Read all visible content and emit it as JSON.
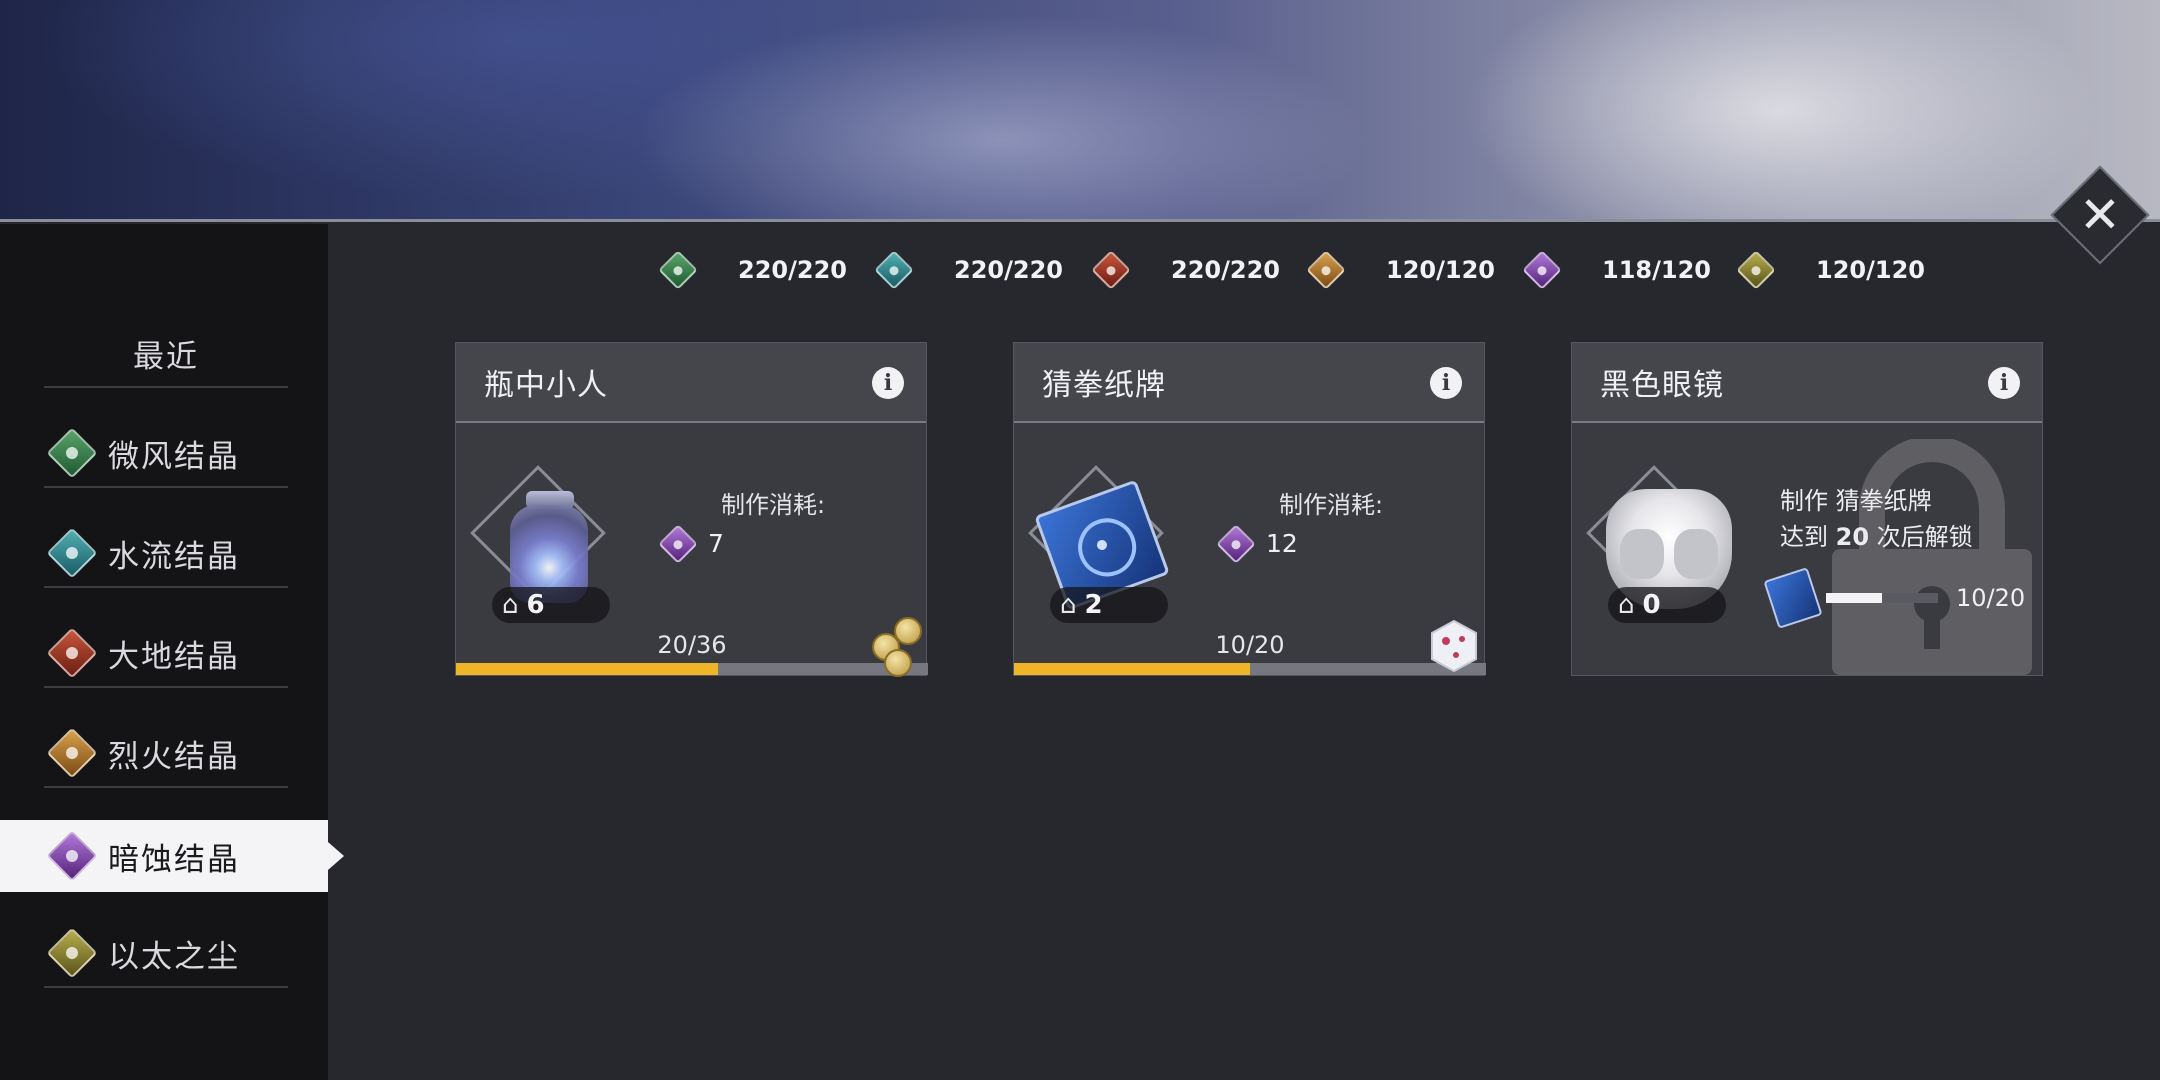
{
  "resources": [
    {
      "icon": "wind-crystal-icon",
      "value": "220/220"
    },
    {
      "icon": "water-crystal-icon",
      "value": "220/220"
    },
    {
      "icon": "earth-crystal-icon",
      "value": "220/220"
    },
    {
      "icon": "fire-crystal-icon",
      "value": "120/120"
    },
    {
      "icon": "dark-crystal-icon",
      "value": "118/120"
    },
    {
      "icon": "ether-dust-icon",
      "value": "120/120"
    }
  ],
  "sidebar": {
    "recent": "最近",
    "items": [
      {
        "label": "微风结晶",
        "icon": "wind-crystal-icon"
      },
      {
        "label": "水流结晶",
        "icon": "water-crystal-icon"
      },
      {
        "label": "大地结晶",
        "icon": "earth-crystal-icon"
      },
      {
        "label": "烈火结晶",
        "icon": "fire-crystal-icon"
      },
      {
        "label": "暗蚀结晶",
        "icon": "dark-crystal-icon",
        "active": true
      },
      {
        "label": "以太之尘",
        "icon": "ether-dust-icon"
      }
    ]
  },
  "cards": [
    {
      "title": "瓶中小人",
      "stock": "6",
      "cost_label": "制作消耗:",
      "cost": "7",
      "progress_text": "20/36",
      "progress": 0.555
    },
    {
      "title": "猜拳纸牌",
      "stock": "2",
      "cost_label": "制作消耗:",
      "cost": "12",
      "progress_text": "10/20",
      "progress": 0.5
    },
    {
      "title": "黑色眼镜",
      "stock": "0",
      "locked": true,
      "unlock_line1_prefix": "制作 ",
      "unlock_line1_item": "猜拳纸牌",
      "unlock_line2_prefix": "达到 ",
      "unlock_line2_count": "20",
      "unlock_line2_suffix": " 次后解锁",
      "unlock_progress_text": "10/20",
      "unlock_progress": 0.5
    }
  ],
  "colors": {
    "progress": "#f0b429",
    "panel": "#3a3b41",
    "sidebar": "#141417",
    "active_tab": "#f4f4f6"
  }
}
